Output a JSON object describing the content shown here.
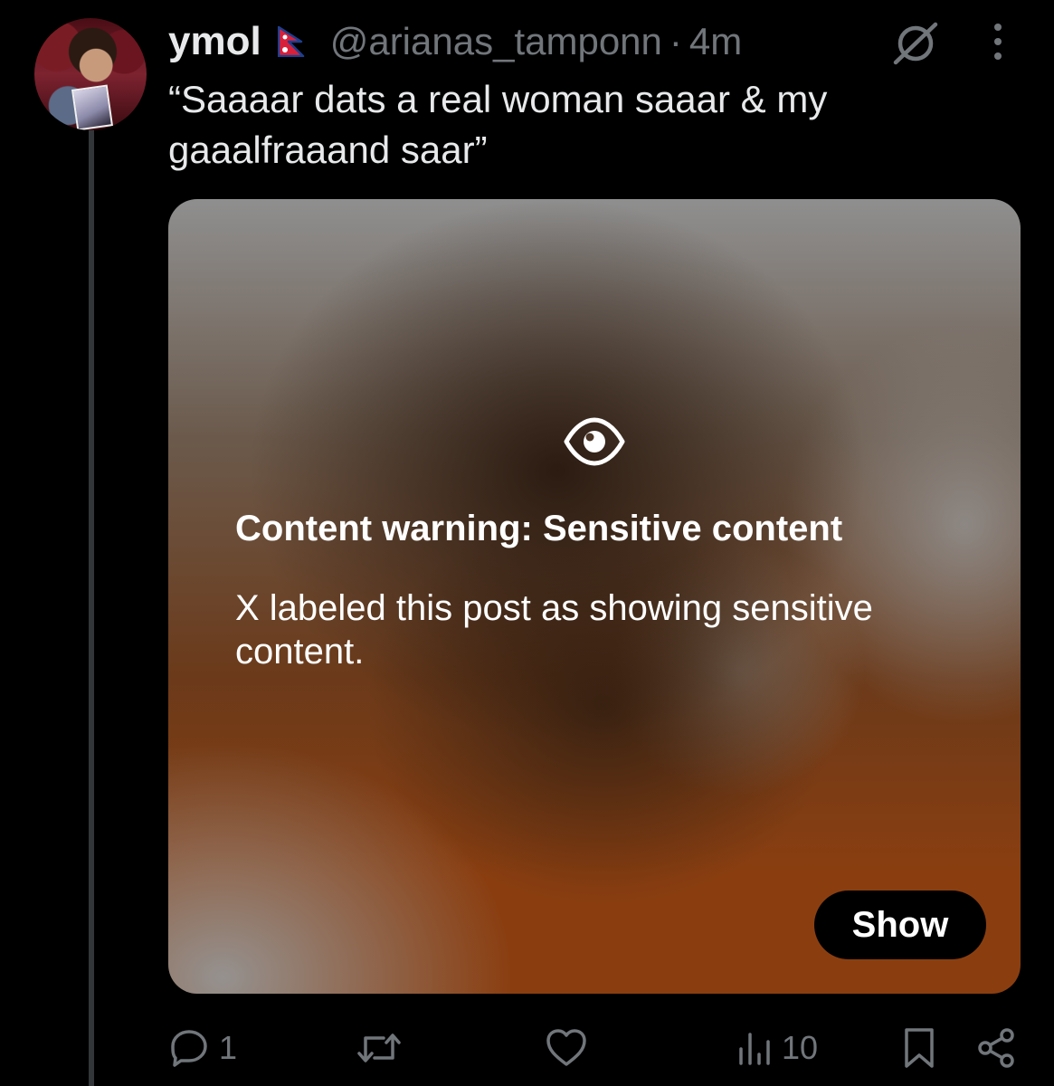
{
  "post": {
    "display_name": "ymol",
    "flag_icon": "nepal-flag-icon",
    "handle": "@arianas_tamponn",
    "separator": "·",
    "time": "4m",
    "text": "“Saaaar dats a real woman saaar & my gaaalfraaand saar”"
  },
  "media": {
    "warning_title": "Content warning: Sensitive content",
    "warning_body": "X labeled this post as showing sensitive content.",
    "show_label": "Show"
  },
  "actions": {
    "replies": "1",
    "views": "10"
  },
  "colors": {
    "background": "#000000",
    "text_primary": "#e7e9ea",
    "text_secondary": "#71767b",
    "button_bg": "#000000"
  }
}
